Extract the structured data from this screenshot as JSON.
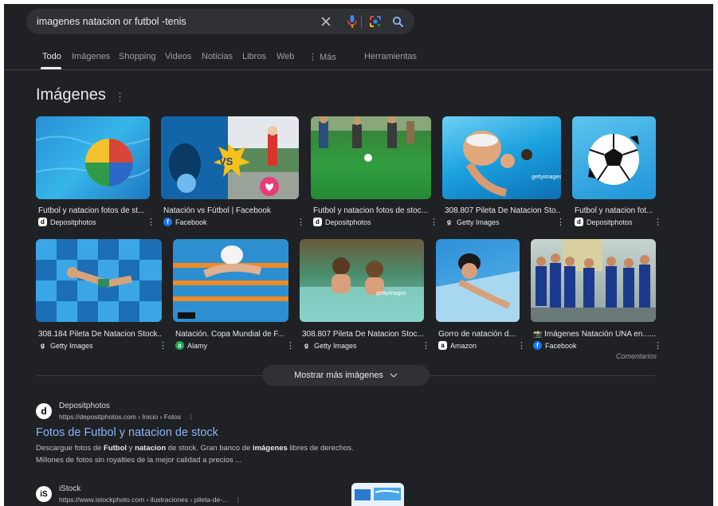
{
  "search": {
    "query": "imagenes natacion or futbol -tenis",
    "clear_icon": "close-icon",
    "mic_icon": "microphone-icon",
    "lens_icon": "lens-icon",
    "search_icon": "search-icon"
  },
  "tabs": [
    {
      "label": "Todo"
    },
    {
      "label": "Imágenes"
    },
    {
      "label": "Shopping"
    },
    {
      "label": "Videos"
    },
    {
      "label": "Noticias"
    },
    {
      "label": "Libros"
    },
    {
      "label": "Web"
    },
    {
      "label": "⋮ Más"
    },
    {
      "label": "Herramientas"
    }
  ],
  "images_section": {
    "title": "Imágenes",
    "menu": "⋮",
    "row1": [
      {
        "caption": "Futbol y natacion fotos de st...",
        "source": "Depositphotos"
      },
      {
        "caption": "Natación vs Fútbol | Facebook",
        "source": "Facebook"
      },
      {
        "caption": "Futbol y natacion fotos de stoc...",
        "source": "Depositphotos"
      },
      {
        "caption": "308.807 Pileta De Natacion Sto...",
        "source": "Getty Images"
      },
      {
        "caption": "Futbol y natacion fot...",
        "source": "Depositphotos"
      }
    ],
    "row2": [
      {
        "caption": "308.184 Pileta De Natacion Stock...",
        "source": "Getty Images"
      },
      {
        "caption": "Natación. Copa Mundial de F...",
        "source": "Alamy"
      },
      {
        "caption": "308.807 Pileta De Natacion Stoc...",
        "source": "Getty Images"
      },
      {
        "caption": "Gorro de natación d...",
        "source": "Amazon"
      },
      {
        "caption": "Imágenes Natación UNA en......",
        "source": "Facebook"
      }
    ],
    "feedback": "Comentarios",
    "show_more": "Mostrar más imágenes"
  },
  "results": [
    {
      "site": "Depositphotos",
      "url": "https://depositphotos.com › Inicio › Fotos",
      "title": "Fotos de Futbol y natacion de stock",
      "snippet": {
        "p1": "Descargue fotos de ",
        "b1": "Futbol",
        "p2": " y ",
        "b2": "natacion",
        "p3": " de stock. Gran banco de ",
        "b3": "imágenes",
        "p4": " libres de derechos.",
        "line2": "Millones de fotos sin royalties de la mejor calidad a precios ..."
      }
    },
    {
      "site": "iStock",
      "url": "https://www.istockphoto.com › ilustraciones › pileta-de-..."
    }
  ],
  "colors": {
    "background": "#202124",
    "link": "#8ab4f8",
    "mic": "#ea4335"
  }
}
